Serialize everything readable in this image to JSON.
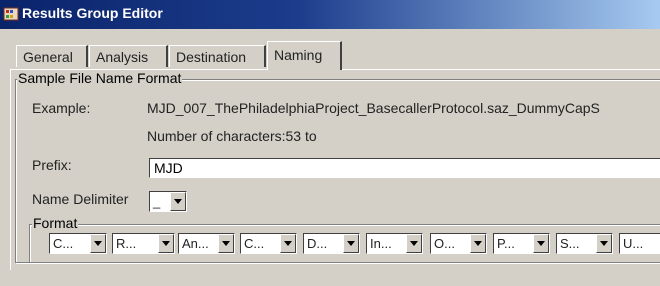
{
  "window": {
    "title": "Results Group Editor",
    "icon": "app-icon"
  },
  "tabs": [
    {
      "label": "General"
    },
    {
      "label": "Analysis"
    },
    {
      "label": "Destination"
    },
    {
      "label": "Naming",
      "active": true
    }
  ],
  "sample_file_name_format": {
    "legend": "Sample File Name Format",
    "example_label": "Example:",
    "example_value": "MJD_007_ThePhiladelphiaProject_BasecallerProtocol.saz_DummyCapS",
    "char_count_text": "Number of characters:53 to",
    "prefix_label": "Prefix:",
    "prefix_value": "MJD",
    "delimiter_label": "Name Delimiter",
    "delimiter_value": "_",
    "format": {
      "legend": "Format",
      "items": [
        "C...",
        "R...",
        "An...",
        "C...",
        "D...",
        "In...",
        "O...",
        "P...",
        "S...",
        "U..."
      ]
    }
  }
}
